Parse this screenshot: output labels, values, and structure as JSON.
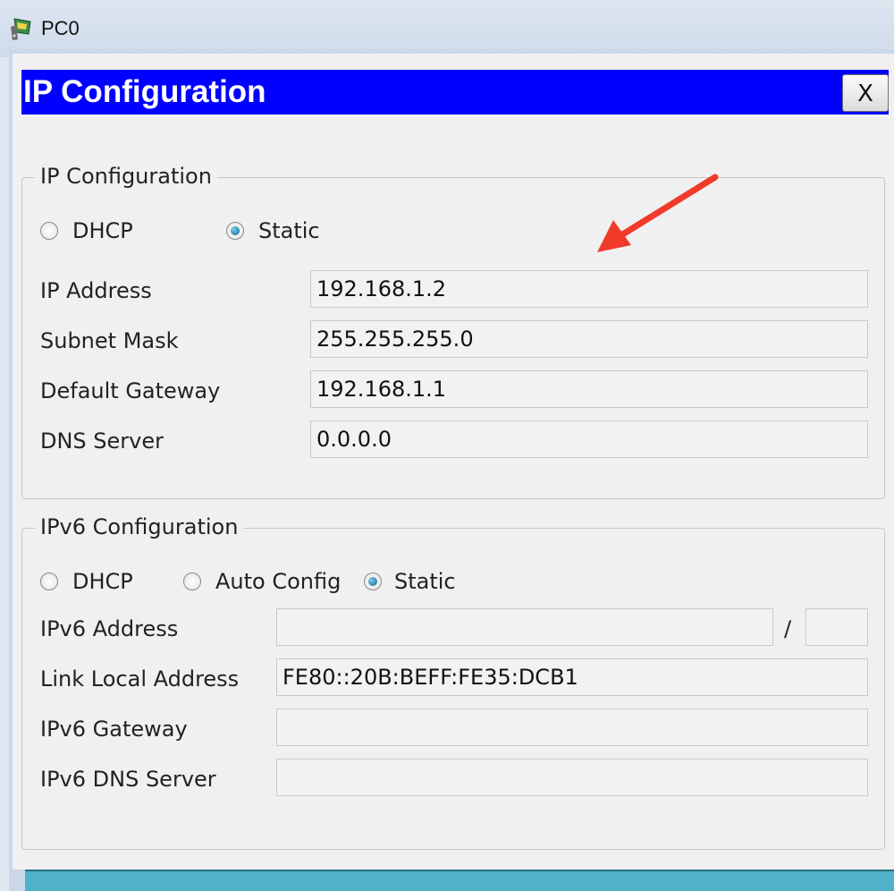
{
  "window": {
    "title": "PC0"
  },
  "dialog": {
    "title": "IP Configuration",
    "close_label": "X"
  },
  "ipv4": {
    "legend": "IP Configuration",
    "options": {
      "dhcp": "DHCP",
      "static": "Static"
    },
    "selected": "static",
    "fields": {
      "ip_address": {
        "label": "IP Address",
        "value": "192.168.1.2"
      },
      "subnet_mask": {
        "label": "Subnet Mask",
        "value": "255.255.255.0"
      },
      "default_gateway": {
        "label": "Default Gateway",
        "value": "192.168.1.1"
      },
      "dns_server": {
        "label": "DNS Server",
        "value": "0.0.0.0"
      }
    }
  },
  "ipv6": {
    "legend": "IPv6 Configuration",
    "options": {
      "dhcp": "DHCP",
      "auto": "Auto Config",
      "static": "Static"
    },
    "selected": "static",
    "fields": {
      "address": {
        "label": "IPv6 Address",
        "value": "",
        "prefix": ""
      },
      "link_local": {
        "label": "Link Local Address",
        "value": "FE80::20B:BEFF:FE35:DCB1"
      },
      "gateway": {
        "label": "IPv6 Gateway",
        "value": ""
      },
      "dns_server": {
        "label": "IPv6 DNS Server",
        "value": ""
      }
    },
    "prefix_separator": "/"
  },
  "annotation": {
    "arrow_color": "#f03a2a",
    "icon": "red-arrow-icon"
  },
  "colors": {
    "header_bg": "#0000ff",
    "window_bg": "#f0f0f0",
    "bottom_strip": "#4fb2c8"
  }
}
